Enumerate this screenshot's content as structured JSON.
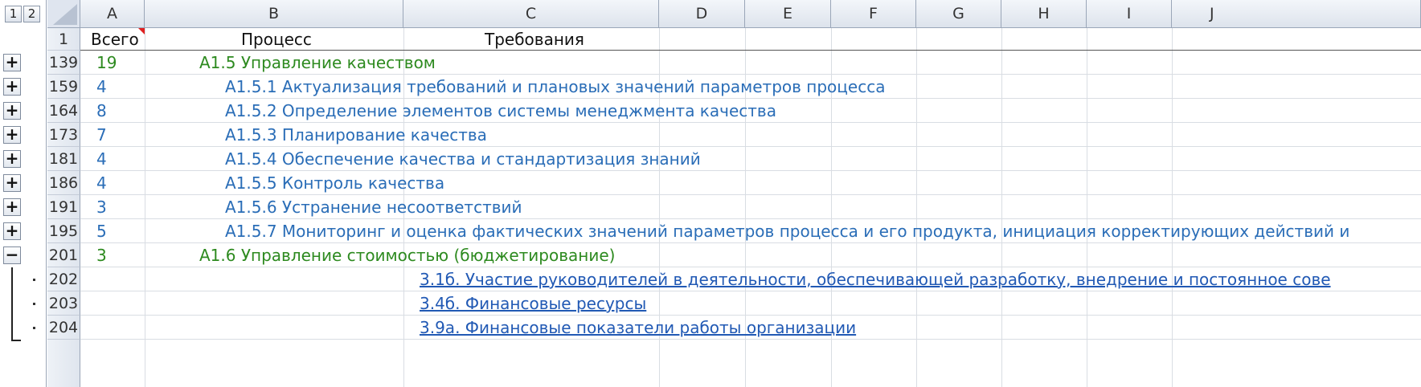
{
  "outline_levels": [
    "1",
    "2"
  ],
  "columns": [
    "A",
    "B",
    "C",
    "D",
    "E",
    "F",
    "G",
    "H",
    "I",
    "J"
  ],
  "header_row": {
    "row_number": "1",
    "col_a": "Всего",
    "col_b": "Процесс",
    "col_c": "Требования"
  },
  "rows": [
    {
      "row_number": "139",
      "count": "19",
      "text": "А1.5 Управление качеством",
      "toggle": "+"
    },
    {
      "row_number": "159",
      "count": "4",
      "text": "А1.5.1 Актуализация требований и плановых значений параметров процесса",
      "toggle": "+"
    },
    {
      "row_number": "164",
      "count": "8",
      "text": "А1.5.2 Определение элементов системы менеджмента качества",
      "toggle": "+"
    },
    {
      "row_number": "173",
      "count": "7",
      "text": "А1.5.3 Планирование качества",
      "toggle": "+"
    },
    {
      "row_number": "181",
      "count": "4",
      "text": "А1.5.4 Обеспечение качества и стандартизация знаний",
      "toggle": "+"
    },
    {
      "row_number": "186",
      "count": "4",
      "text": "А1.5.5 Контроль качества",
      "toggle": "+"
    },
    {
      "row_number": "191",
      "count": "3",
      "text": "А1.5.6 Устранение несоответствий",
      "toggle": "+"
    },
    {
      "row_number": "195",
      "count": "5",
      "text": "А1.5.7 Мониторинг и оценка фактических значений параметров процесса и его продукта, инициация корректирующих действий и",
      "toggle": "+"
    },
    {
      "row_number": "201",
      "count": "3",
      "text": "А1.6 Управление стоимостью (бюджетирование)",
      "toggle": "−"
    },
    {
      "row_number": "202",
      "count": "",
      "text": "3.1б. Участие руководителей в деятельности, обеспечивающей разработку, внедрение и постоянное сове",
      "toggle": ""
    },
    {
      "row_number": "203",
      "count": "",
      "text": "3.4б. Финансовые ресурсы",
      "toggle": ""
    },
    {
      "row_number": "204",
      "count": "",
      "text": "3.9а. Финансовые показатели работы организации",
      "toggle": ""
    }
  ],
  "colors": {
    "section_text": "#2d8a1f",
    "subsection_text": "#2a6db7",
    "link_text": "#2159b4"
  }
}
